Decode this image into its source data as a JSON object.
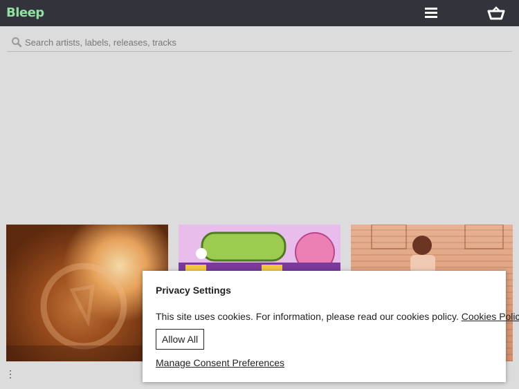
{
  "header": {
    "logo": "Bleep",
    "menu_icon": "hamburger-menu-icon",
    "cart_icon": "basket-icon"
  },
  "search": {
    "icon": "search-icon",
    "placeholder": "Search artists, labels, releases, tracks",
    "value": ""
  },
  "tiles": [
    {
      "art": "orange-abstract-cover",
      "color": "#b2622a"
    },
    {
      "art": "graffiti-cover",
      "color": "#d08fd6"
    },
    {
      "art": "portrait-cover",
      "color": "#dc9c78"
    }
  ],
  "more_glyph": "⋮",
  "cookie_banner": {
    "title": "Privacy Settings",
    "text": "This site uses cookies. For information, please read our cookies policy.",
    "policy_link": "Cookies Policy",
    "allow_button": "Allow All",
    "manage_link": "Manage Consent Preferences"
  },
  "colors": {
    "header_bg": "#33333b",
    "logo": "#8fe3a0",
    "page_bg": "#dcdcdc"
  }
}
